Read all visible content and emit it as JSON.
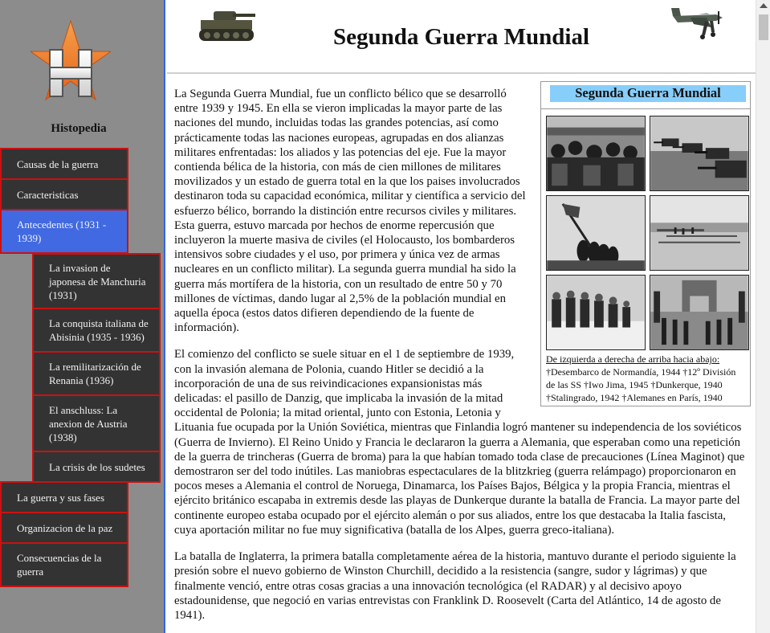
{
  "sidebar": {
    "site_name": "Histopedia",
    "items": [
      {
        "label": "Causas de la guerra"
      },
      {
        "label": "Caracteristicas"
      },
      {
        "label": "Antecedentes (1931 - 1939)"
      },
      {
        "label": "La invasion de japonesa de Manchuria (1931)"
      },
      {
        "label": "La conquista italiana de Abisinia (1935 - 1936)"
      },
      {
        "label": "La remilitarización de Renania (1936)"
      },
      {
        "label": "El anschluss: La anexion de Austria (1938)"
      },
      {
        "label": "La crisis de los sudetes"
      },
      {
        "label": "La guerra y sus fases"
      },
      {
        "label": "Organizacion de la paz"
      },
      {
        "label": "Consecuencias de la guerra"
      }
    ]
  },
  "header": {
    "title": "Segunda Guerra Mundial"
  },
  "infobox": {
    "title": "Segunda Guerra Mundial",
    "caption_title": "De izquierda a derecha de arriba hacia abajo:",
    "caption_body": "†Desembarco de Normandía, 1944 †12º División de las SS †Iwo Jima, 1945 †Dunkerque, 1940 †Stalingrado, 1942 †Alemanes en París, 1940"
  },
  "content": {
    "paragraphs": [
      "La Segunda Guerra Mundial, fue un conflicto bélico que se desarrolló entre 1939 y 1945. En ella se vieron implicadas la mayor parte de las naciones del mundo, incluidas todas las grandes potencias, así como prácticamente todas las naciones europeas, agrupadas en dos alianzas militares enfrentadas: los aliados y las potencias del eje. Fue la mayor contienda bélica de la historia, con más de cien millones de militares movilizados y un estado de guerra total en la que los paises involucrados destinaron toda su capacidad económica, militar y científica a servicio del esfuerzo bélico, borrando la distinción entre recursos civiles y militares. Esta guerra, estuvo marcada por hechos de enorme repercusión que incluyeron la muerte masiva de civiles (el Holocausto, los bombarderos intensivos sobre ciudades y el uso, por primera y única vez de armas nucleares en un conflicto militar). La segunda guerra mundial ha sido la guerra más mortífera de la historia, con un resultado de entre 50 y 70 millones de víctimas, dando lugar al 2,5% de la población mundial en aquella época (estos datos difieren dependiendo de la fuente de información).",
      "El comienzo del conflicto se suele situar en el 1 de septiembre de 1939, con la invasión alemana de Polonia, cuando Hitler se decidió a la incorporación de una de sus reivindicaciones expansionistas más delicadas: el pasillo de Danzig, que implicaba la invasión de la mitad occidental de Polonia; la mitad oriental, junto con Estonia, Letonia y Lituania fue ocupada por la Unión Soviética, mientras que Finlandia logró mantener su independencia de los soviéticos (Guerra de Invierno). El Reino Unido y Francia le declararon la guerra a Alemania, que esperaban como una repetición de la guerra de trincheras (Guerra de broma) para la que habían tomado toda clase de precauciones (Línea Maginot) que demostraron ser del todo inútiles. Las maniobras espectaculares de la blitzkrieg (guerra relámpago) proporcionaron en pocos meses a Alemania el control de Noruega, Dinamarca, los Países Bajos, Bélgica y la propia Francia, mientras el ejército británico escapaba in extremis desde las playas de Dunkerque durante la batalla de Francia. La mayor parte del continente europeo estaba ocupado por el ejército alemán o por sus aliados, entre los que destacaba la Italia fascista, cuya aportación militar no fue muy significativa (batalla de los Alpes, guerra greco-italiana).",
      "La batalla de Inglaterra, la primera batalla completamente aérea de la historia, mantuvo durante el periodo siguiente la presión sobre el nuevo gobierno de Winston Churchill, decidido a la resistencia (sangre, sudor y lágrimas) y que finalmente venció, entre otras cosas gracias a una innovación tecnológica (el RADAR) y al decisivo apoyo estadounidense, que negoció en varias entrevistas con Franklink D. Roosevelt (Carta del Atlántico, 14 de agosto de 1941)."
    ]
  }
}
